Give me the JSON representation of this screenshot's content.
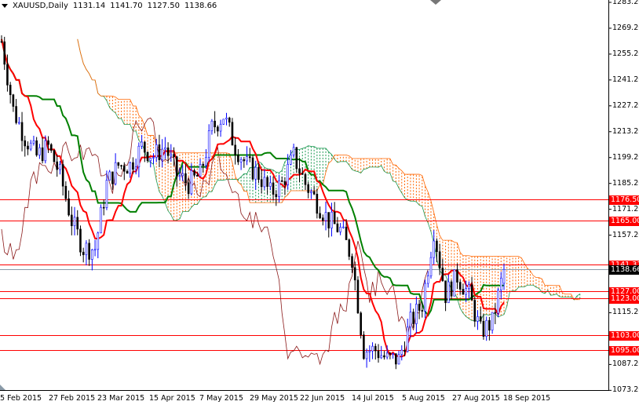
{
  "header": {
    "symbol": "XAUUSD,Daily",
    "open": "1131.14",
    "high": "1141.70",
    "low": "1127.50",
    "close": "1138.66"
  },
  "price_axis": [
    "1283.20",
    "1269.20",
    "1255.20",
    "1241.20",
    "1227.20",
    "1213.20",
    "1199.20",
    "1185.20",
    "1171.20",
    "1157.20",
    "1115.20",
    "1087.20",
    "1073.20"
  ],
  "levels": [
    {
      "price": 1176.5,
      "label": "1176.50"
    },
    {
      "price": 1165.0,
      "label": "1165.00"
    },
    {
      "price": 1141.31,
      "label": "1141.31"
    },
    {
      "price": 1127.0,
      "label": "1127.00"
    },
    {
      "price": 1123.0,
      "label": "1123.00"
    },
    {
      "price": 1103.0,
      "label": "1103.00"
    },
    {
      "price": 1095.0,
      "label": "1095.00"
    }
  ],
  "current_price": {
    "price": 1138.66,
    "label": "1138.66"
  },
  "date_axis": [
    "5 Feb 2015",
    "27 Feb 2015",
    "23 Mar 2015",
    "15 Apr 2015",
    "7 May 2015",
    "29 May 2015",
    "22 Jun 2015",
    "14 Jul 2015",
    "5 Aug 2015",
    "27 Aug 2015",
    "18 Sep 2015"
  ],
  "colors": {
    "up": "#0000ff",
    "down": "#000000",
    "tenkan": "#ff0000",
    "kijun": "#008000",
    "chikou": "#8b1a1a",
    "cloud_bull": "#1a9850",
    "cloud_bear": "#ff6600",
    "level": "#ff0000"
  },
  "chart_data": {
    "type": "line",
    "title": "XAUUSD,Daily",
    "ylim": [
      1073.2,
      1285
    ],
    "approx_closes": [
      1262,
      1225,
      1210,
      1200,
      1205,
      1190,
      1165,
      1150,
      1150,
      1185,
      1195,
      1195,
      1205,
      1200,
      1205,
      1190,
      1185,
      1190,
      1215,
      1222,
      1205,
      1195,
      1190,
      1180,
      1185,
      1200,
      1185,
      1175,
      1165,
      1160,
      1145,
      1095,
      1095,
      1090,
      1090,
      1110,
      1120,
      1160,
      1125,
      1135,
      1125,
      1105,
      1110,
      1138.66
    ]
  }
}
